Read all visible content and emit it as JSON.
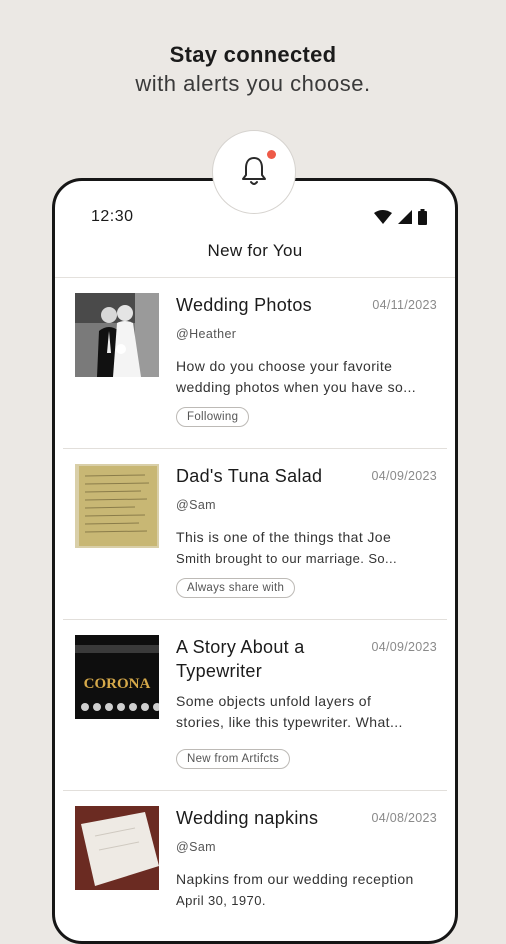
{
  "promo": {
    "headline": "Stay connected",
    "subheadline": "with alerts you choose.",
    "bell_dot_color": "#ee5a48"
  },
  "status_bar": {
    "time": "12:30",
    "icons": [
      "wifi-icon",
      "signal-icon",
      "battery-icon"
    ]
  },
  "app_bar": {
    "title": "New for You"
  },
  "feed": [
    {
      "title": "Wedding Photos",
      "date": "04/11/2023",
      "author": "@Heather",
      "body_line1": "How do you choose your favorite",
      "body_line2": "wedding photos when you have so...",
      "tag": "Following",
      "thumb": "wedding-couple-photo"
    },
    {
      "title": "Dad's Tuna Salad",
      "date": "04/09/2023",
      "author": "@Sam",
      "body_line1": "This is one of the things that Joe",
      "body_line2": "Smith brought to our marriage. So...",
      "tag": "Always share with",
      "thumb": "handwritten-recipe-photo"
    },
    {
      "title_line1": "A Story About a",
      "title_line2": "Typewriter",
      "date": "04/09/2023",
      "body_line1": "Some objects unfold layers of",
      "body_line2": "stories, like this typewriter. What...",
      "tag": "New from Artifcts",
      "thumb": "corona-typewriter-photo",
      "thumb_text": "CORONA"
    },
    {
      "title": "Wedding napkins",
      "date": "04/08/2023",
      "author": "@Sam",
      "body_line1": "Napkins from our wedding reception",
      "body_line2": "April 30, 1970.",
      "thumb": "napkin-photo"
    }
  ]
}
